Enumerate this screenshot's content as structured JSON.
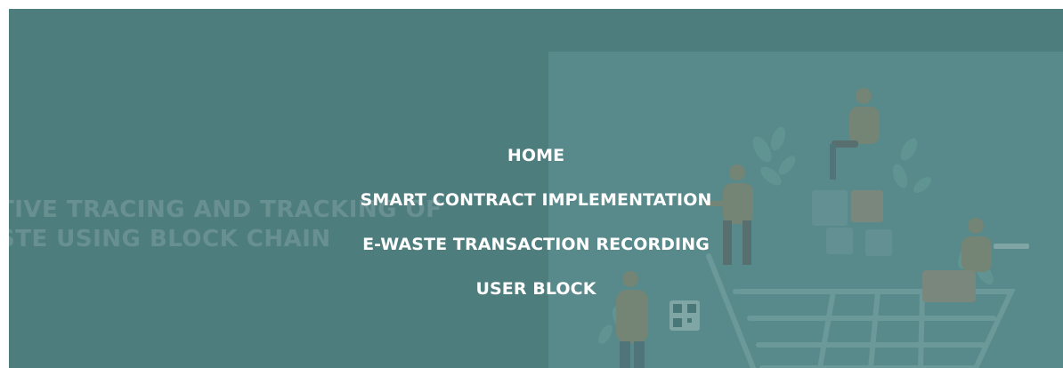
{
  "hero": {
    "background_title_lines": [
      "TIVE TRACING AND TRACKING OF",
      "STE USING BLOCK CHAIN"
    ]
  },
  "nav": {
    "items": [
      {
        "label": "HOME"
      },
      {
        "label": "SMART CONTRACT IMPLEMENTATION"
      },
      {
        "label": "E-WASTE TRANSACTION RECORDING"
      },
      {
        "label": "USER BLOCK"
      }
    ]
  },
  "colors": {
    "overlay": "#4e7d7e",
    "art_panel": "#588a8b",
    "text": "#ffffff"
  }
}
